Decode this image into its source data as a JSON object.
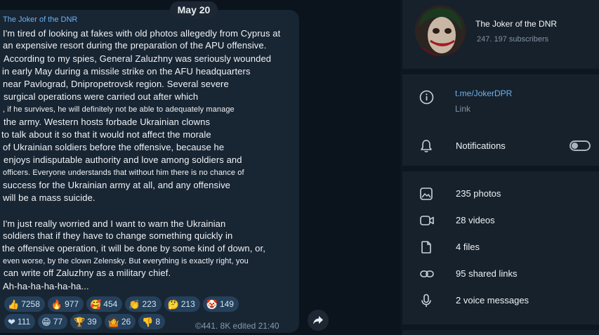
{
  "chat": {
    "date": "May 20",
    "channel_name": "The Joker of the DNR",
    "message_lines": [
      {
        "text": "I'm tired of looking at fakes with old photos allegedly from Cyprus at",
        "small": false
      },
      {
        "text": " an expensive resort during the preparation of the APU offensive.",
        "small": false
      },
      {
        "text": " According to my spies, General Zaluzhny was seriously wounded",
        "small": false
      },
      {
        "text": "in early May during a missile strike on the AFU headquarters",
        "small": false
      },
      {
        "text": " near Pavlograd, Dnipropetrovsk region. Several severe",
        "small": false
      },
      {
        "text": " surgical operations were carried out after which",
        "small": false
      },
      {
        "text": " , if he survives, he will definitely not be able to adequately manage",
        "small": true
      },
      {
        "text": " the army. Western hosts forbade Ukrainian clowns",
        "small": false
      },
      {
        "text": "to talk about it so that it would not affect the morale",
        "small": false
      },
      {
        "text": " of Ukrainian soldiers before the offensive, because he",
        "small": false
      },
      {
        "text": " enjoys indisputable authority and love among soldiers and",
        "small": false
      },
      {
        "text": " officers. Everyone understands that without him there is no chance of",
        "small": true
      },
      {
        "text": " success for the Ukrainian army at all, and any offensive",
        "small": false
      },
      {
        "text": " will be a mass suicide.",
        "small": false
      },
      {
        "text": "I'm just really worried and I want to warn the Ukrainian",
        "small": false
      },
      {
        "text": " soldiers that if they have to change something quickly in",
        "small": false
      },
      {
        "text": " the offensive operation, it will be done by some kind of down, or,",
        "small": false
      },
      {
        "text": " even worse, by the clown Zelensky. But everything is exactly right, you",
        "small": true
      },
      {
        "text": "  can write off Zaluzhny as a military chief.",
        "small": false
      },
      {
        "text": " Ah-ha-ha-ha-ha-ha...",
        "small": false
      }
    ],
    "reactions_row1": [
      {
        "icon": "thumbs-up-icon",
        "emoji": "👍",
        "count": "7258"
      },
      {
        "icon": "fire-icon",
        "emoji": "🔥",
        "count": "977"
      },
      {
        "icon": "kissing-face-icon",
        "emoji": "🥰",
        "count": "454"
      },
      {
        "icon": "clapping-icon",
        "emoji": "👏",
        "count": "223"
      },
      {
        "icon": "thinking-face-icon",
        "emoji": "🤔",
        "count": "213"
      },
      {
        "icon": "clown-face-icon",
        "emoji": "🤡",
        "count": "149"
      }
    ],
    "reactions_row2": [
      {
        "icon": "heart-icon",
        "emoji": "❤",
        "count": "111"
      },
      {
        "icon": "grinning-face-icon",
        "emoji": "😁",
        "count": "77"
      },
      {
        "icon": "trophy-icon",
        "emoji": "🏆",
        "count": "39"
      },
      {
        "icon": "shrug-icon",
        "emoji": "🤷",
        "count": "26"
      },
      {
        "icon": "thumbs-down-icon",
        "emoji": "👎",
        "count": "8"
      }
    ],
    "meta": "©441. 8K edited 21:40"
  },
  "panel": {
    "title": "The Joker of the DNR",
    "subscribers": "247. 197 subscribers",
    "link": "t.me/JokerDPR",
    "link_label": "Link",
    "notifications_label": "Notifications",
    "notifications_on": false,
    "media": [
      {
        "icon": "photo-icon",
        "label": "235 photos"
      },
      {
        "icon": "video-icon",
        "label": "28 videos"
      },
      {
        "icon": "file-icon",
        "label": "4 files"
      },
      {
        "icon": "link-icon",
        "label": "95 shared links"
      },
      {
        "icon": "microphone-icon",
        "label": "2 voice messages"
      }
    ]
  },
  "colors": {
    "accent": "#6ab3f3",
    "background": "#0e1621",
    "bubble": "#182533",
    "panel": "#17212b"
  }
}
